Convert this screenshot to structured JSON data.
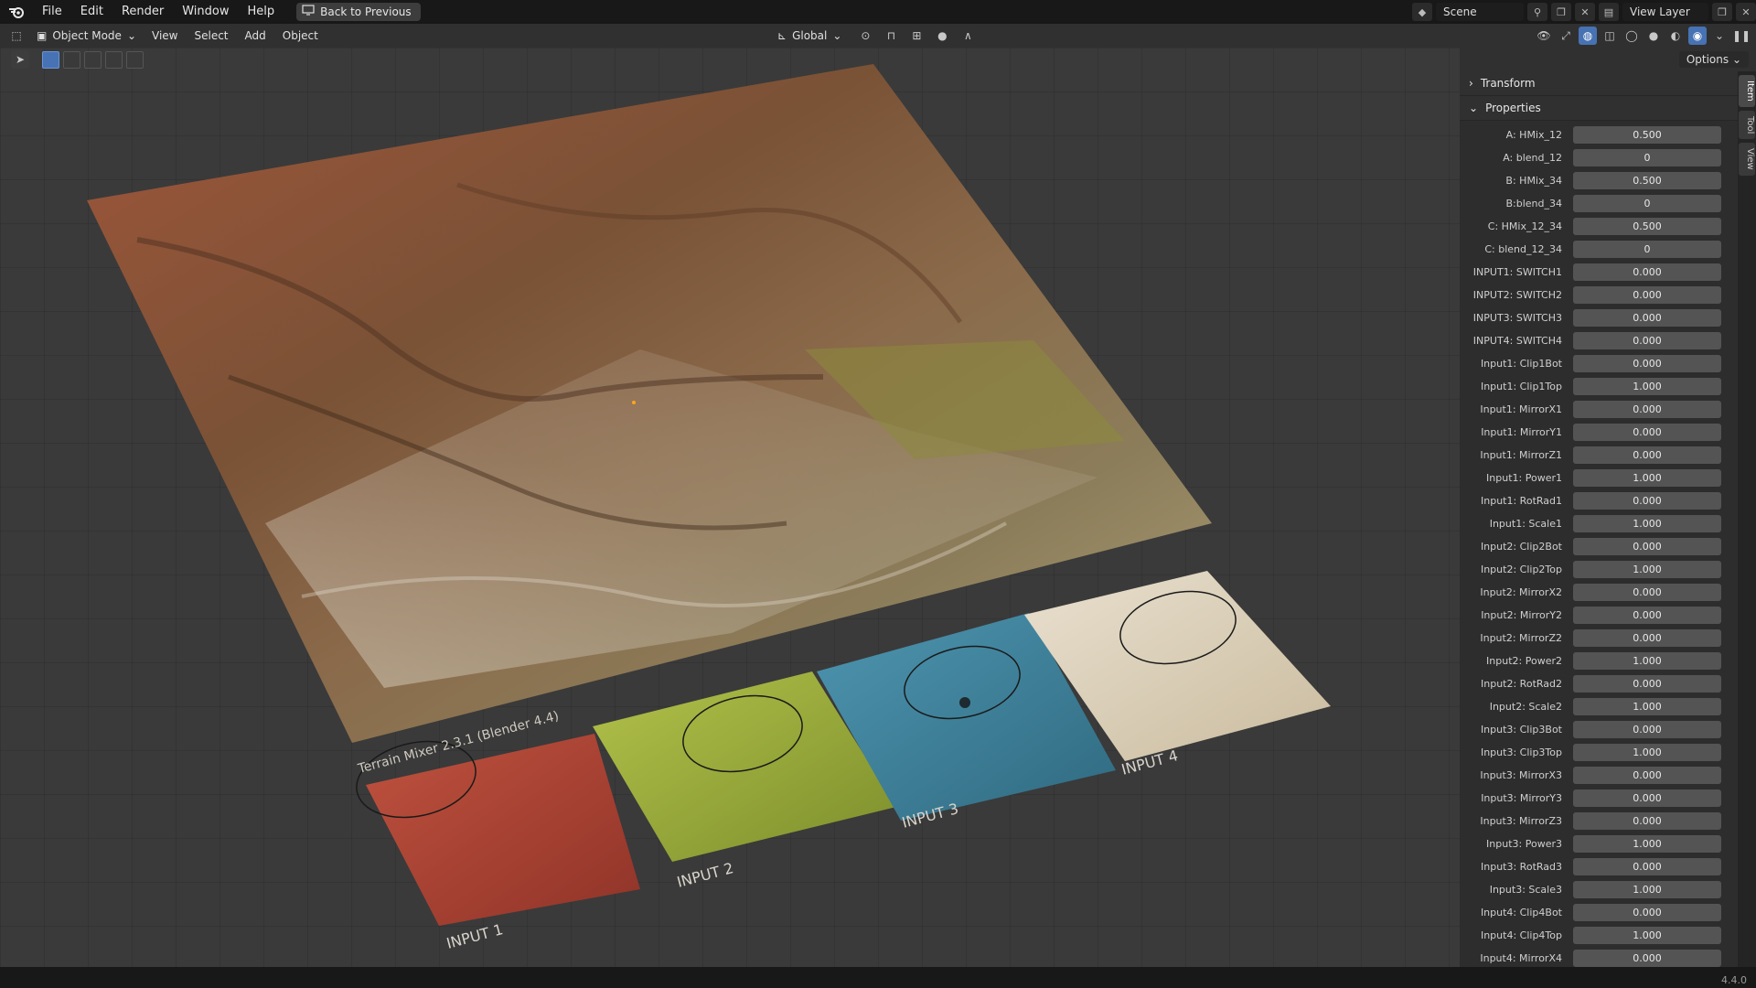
{
  "topbar": {
    "menus": [
      "File",
      "Edit",
      "Render",
      "Window",
      "Help"
    ],
    "back_button": "Back to Previous",
    "scene": "Scene",
    "view_layer": "View Layer"
  },
  "viewport_header": {
    "mode": "Object Mode",
    "menus": [
      "View",
      "Select",
      "Add",
      "Object"
    ],
    "orientation": "Global",
    "options": "Options"
  },
  "viewport": {
    "tile_labels": [
      "INPUT 1",
      "INPUT 2",
      "INPUT 3",
      "INPUT 4"
    ],
    "title_text": "Terrain Mixer 2.3.1 (Blender 4.4)"
  },
  "sidebar": {
    "transform_label": "Transform",
    "properties_label": "Properties",
    "tabs": [
      "Item",
      "Tool",
      "View"
    ],
    "props": [
      {
        "label": "A: HMix_12",
        "value": "0.500"
      },
      {
        "label": "A: blend_12",
        "value": "0"
      },
      {
        "label": "B: HMix_34",
        "value": "0.500"
      },
      {
        "label": "B:blend_34",
        "value": "0"
      },
      {
        "label": "C: HMix_12_34",
        "value": "0.500"
      },
      {
        "label": "C: blend_12_34",
        "value": "0"
      },
      {
        "label": "INPUT1: SWITCH1",
        "value": "0.000"
      },
      {
        "label": "INPUT2: SWITCH2",
        "value": "0.000"
      },
      {
        "label": "INPUT3: SWITCH3",
        "value": "0.000"
      },
      {
        "label": "INPUT4: SWITCH4",
        "value": "0.000"
      },
      {
        "label": "Input1: Clip1Bot",
        "value": "0.000"
      },
      {
        "label": "Input1: Clip1Top",
        "value": "1.000"
      },
      {
        "label": "Input1: MirrorX1",
        "value": "0.000"
      },
      {
        "label": "Input1: MirrorY1",
        "value": "0.000"
      },
      {
        "label": "Input1: MirrorZ1",
        "value": "0.000"
      },
      {
        "label": "Input1: Power1",
        "value": "1.000"
      },
      {
        "label": "Input1: RotRad1",
        "value": "0.000"
      },
      {
        "label": "Input1: Scale1",
        "value": "1.000"
      },
      {
        "label": "Input2: Clip2Bot",
        "value": "0.000"
      },
      {
        "label": "Input2: Clip2Top",
        "value": "1.000"
      },
      {
        "label": "Input2: MirrorX2",
        "value": "0.000"
      },
      {
        "label": "Input2: MirrorY2",
        "value": "0.000"
      },
      {
        "label": "Input2: MirrorZ2",
        "value": "0.000"
      },
      {
        "label": "Input2: Power2",
        "value": "1.000"
      },
      {
        "label": "Input2: RotRad2",
        "value": "0.000"
      },
      {
        "label": "Input2: Scale2",
        "value": "1.000"
      },
      {
        "label": "Input3: Clip3Bot",
        "value": "0.000"
      },
      {
        "label": "Input3: Clip3Top",
        "value": "1.000"
      },
      {
        "label": "Input3: MirrorX3",
        "value": "0.000"
      },
      {
        "label": "Input3: MirrorY3",
        "value": "0.000"
      },
      {
        "label": "Input3: MirrorZ3",
        "value": "0.000"
      },
      {
        "label": "Input3: Power3",
        "value": "1.000"
      },
      {
        "label": "Input3: RotRad3",
        "value": "0.000"
      },
      {
        "label": "Input3: Scale3",
        "value": "1.000"
      },
      {
        "label": "Input4: Clip4Bot",
        "value": "0.000"
      },
      {
        "label": "Input4: Clip4Top",
        "value": "1.000"
      },
      {
        "label": "Input4: MirrorX4",
        "value": "0.000"
      }
    ]
  },
  "status": {
    "version": "4.4.0"
  },
  "colors": {
    "accent": "#4772b3",
    "terrain_brown": "#8a5a3a",
    "input1_red": "#b5473a",
    "input2_green": "#9aac3a",
    "input3_blue": "#3f7f98",
    "input4_sand": "#d9ccb4"
  }
}
